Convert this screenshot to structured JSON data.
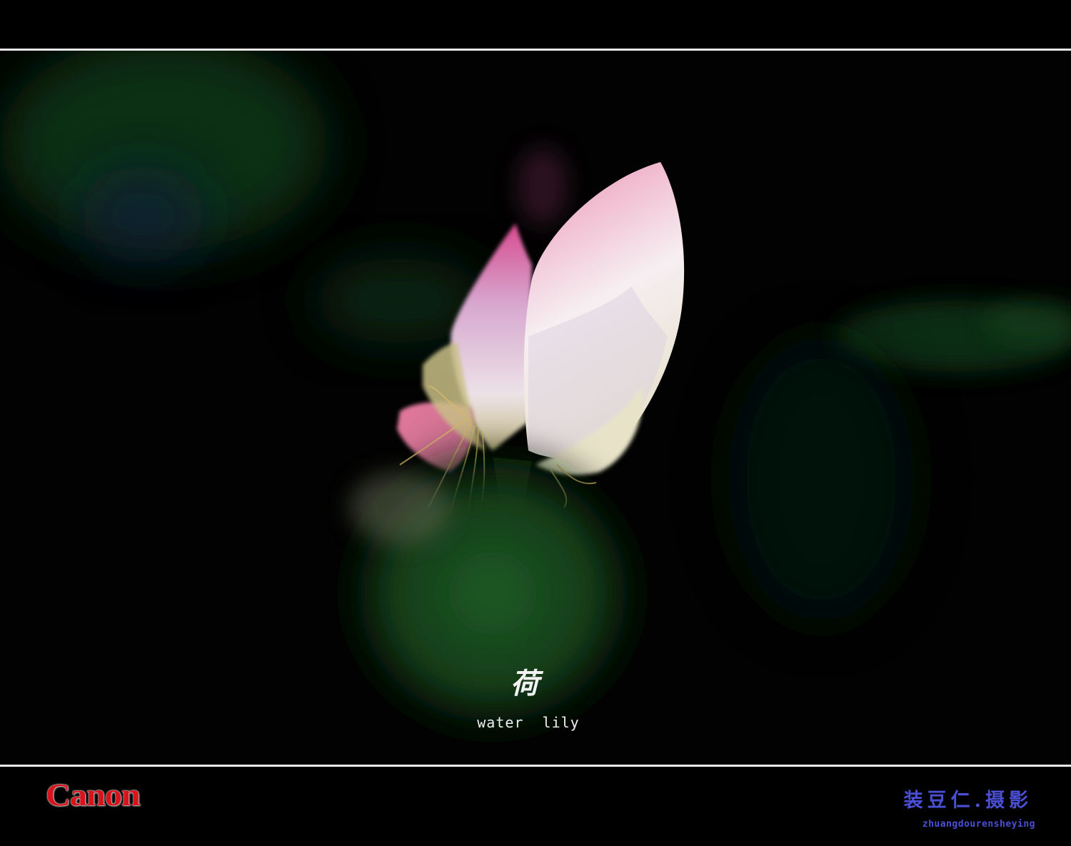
{
  "photo": {
    "subject": "lotus-flower-icon",
    "colors": {
      "background": "#000000",
      "petal_pink": "#e0568f",
      "petal_white": "#f4ecef",
      "leaf_green": "#1e4a24"
    }
  },
  "caption": {
    "chinese_title": "荷",
    "english_title": "water  lily"
  },
  "footer": {
    "brand": "Canon",
    "brand_color": "#d8131b",
    "signature": "装豆仁.摄影",
    "signature_romanized": "zhuangdourensheying",
    "signature_color": "#4a4fd6"
  }
}
